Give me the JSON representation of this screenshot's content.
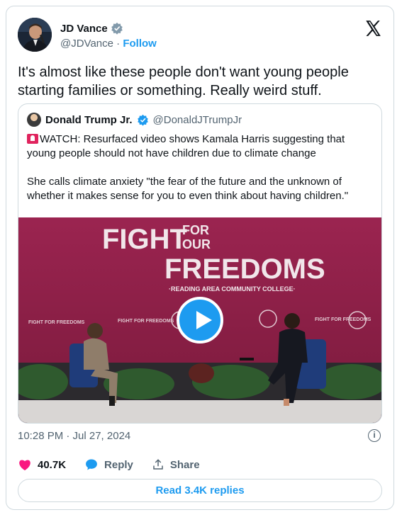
{
  "author": {
    "name": "JD Vance",
    "handle": "@JDVance",
    "separator": "·",
    "follow_label": "Follow"
  },
  "tweet": {
    "text": "It's almost like these people don't want young people starting families or something. Really weird stuff."
  },
  "quote": {
    "name": "Donald Trump Jr.",
    "handle": "@DonaldJTrumpJr",
    "paragraph1": "WATCH: Resurfaced video shows Kamala Harris suggesting that young people should not have children due to climate change",
    "paragraph2": "She calls climate anxiety \"the fear of the future and the unknown of whether it makes sense for you to even think about having children.\""
  },
  "video": {
    "banner_line1": "FIGHT",
    "banner_line2a": "FOR",
    "banner_line2b": "OUR",
    "banner_line3": "FREEDOMS",
    "banner_sub": "·READING AREA COMMUNITY COLLEGE·",
    "sign_text": "FIGHT FOR FREEDOMS"
  },
  "meta": {
    "timestamp": "10:28 PM · Jul 27, 2024",
    "info_glyph": "i"
  },
  "actions": {
    "likes": "40.7K",
    "reply_label": "Reply",
    "share_label": "Share"
  },
  "footer": {
    "read_replies": "Read 3.4K replies"
  },
  "colors": {
    "accent": "#1d9bf0",
    "like": "#f91880",
    "backdrop": "#8a1f45"
  }
}
